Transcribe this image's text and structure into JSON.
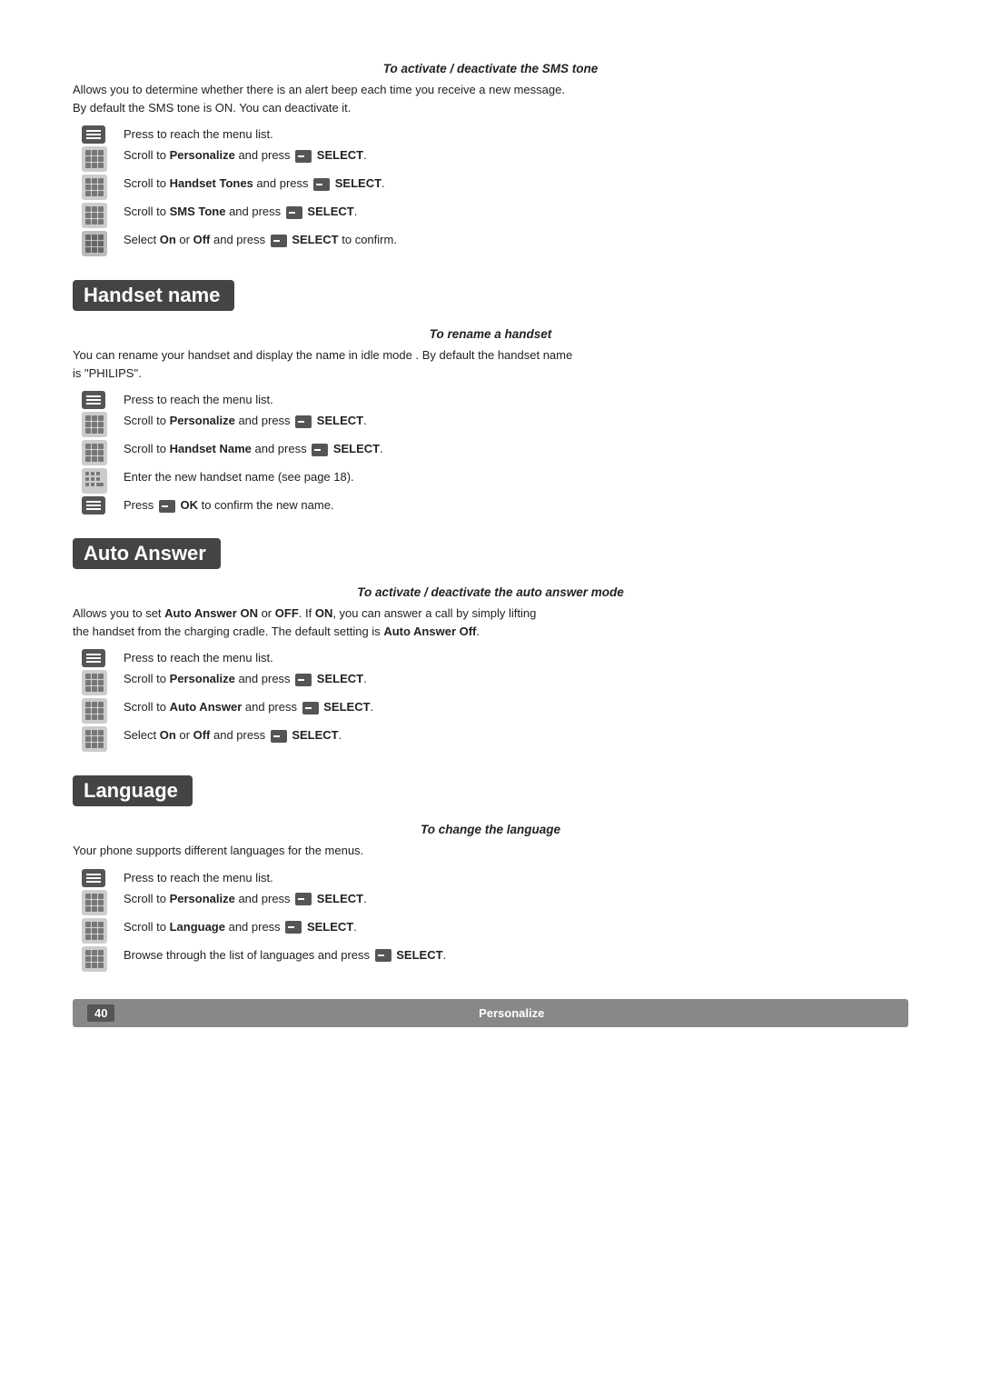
{
  "sms_section": {
    "subsection_title": "To activate / deactivate the SMS tone",
    "description1": "Allows you to determine whether there is an alert beep each time you receive a new message.",
    "description2": "By default the SMS tone is ON. You can deactivate it.",
    "steps": [
      {
        "icon": "menu",
        "text": "Press to reach the menu list."
      },
      {
        "icon": "grid",
        "text": "Scroll to <b>Personalize</b> and press <span class='inline-btn'></span> <b>SELECT</b>."
      },
      {
        "icon": "grid",
        "text": "Scroll to <b>Handset Tones</b> and press <span class='inline-btn'></span> <b>SELECT</b>."
      },
      {
        "icon": "grid",
        "text": "Scroll to <b>SMS Tone</b> and press <span class='inline-btn'></span> <b>SELECT</b>."
      },
      {
        "icon": "grid-lg",
        "text": "Select <b>On</b> or <b>Off</b> and press <span class='inline-btn'></span> <b>SELECT</b> to confirm."
      }
    ]
  },
  "handset_name_section": {
    "title": "Handset name",
    "subsection_title": "To rename a handset",
    "description1": "You can rename your handset and display the name in idle mode . By default the handset name",
    "description2": "is \"PHILIPS\".",
    "steps": [
      {
        "icon": "menu",
        "text": "Press to reach the menu list."
      },
      {
        "icon": "grid",
        "text": "Scroll to <b>Personalize</b> and press <span class='inline-btn'></span> <b>SELECT</b>."
      },
      {
        "icon": "grid",
        "text": "Scroll to <b>Handset Name</b> and press <span class='inline-btn'></span> <b>SELECT</b>."
      },
      {
        "icon": "grid-hash",
        "text": "Enter the new handset name (see page 18)."
      },
      {
        "icon": "menu",
        "text": "Press <span class='inline-btn'></span> <b>OK</b> to confirm the new name."
      }
    ]
  },
  "auto_answer_section": {
    "title": "Auto Answer",
    "subsection_title": "To activate / deactivate the auto answer mode",
    "description1": "Allows you to set <b>Auto Answer ON</b> or <b>OFF</b>. If <b>ON</b>, you can answer a call by simply lifting",
    "description2": "the handset from the charging cradle. The default setting is <b>Auto Answer Off</b>.",
    "steps": [
      {
        "icon": "menu",
        "text": "Press to reach the menu list."
      },
      {
        "icon": "grid",
        "text": "Scroll to <b>Personalize</b> and press <span class='inline-btn'></span> <b>SELECT</b>."
      },
      {
        "icon": "grid",
        "text": "Scroll to <b>Auto Answer</b> and press <span class='inline-btn'></span> <b>SELECT</b>."
      },
      {
        "icon": "grid",
        "text": "Select <b>On</b> or <b>Off</b> and press <span class='inline-btn'></span> <b>SELECT</b>."
      }
    ]
  },
  "language_section": {
    "title": "Language",
    "subsection_title": "To change the language",
    "description1": "Your phone supports different languages for the menus.",
    "steps": [
      {
        "icon": "menu",
        "text": "Press to reach the menu list."
      },
      {
        "icon": "grid",
        "text": "Scroll to <b>Personalize</b> and press <span class='inline-btn'></span> <b>SELECT</b>."
      },
      {
        "icon": "grid",
        "text": "Scroll to <b>Language</b> and press <span class='inline-btn'></span> <b>SELECT</b>."
      },
      {
        "icon": "grid",
        "text": "Browse through the list of languages and press <span class='inline-btn'></span> <b>SELECT</b>."
      }
    ]
  },
  "footer": {
    "page_number": "40",
    "section_title": "Personalize"
  }
}
